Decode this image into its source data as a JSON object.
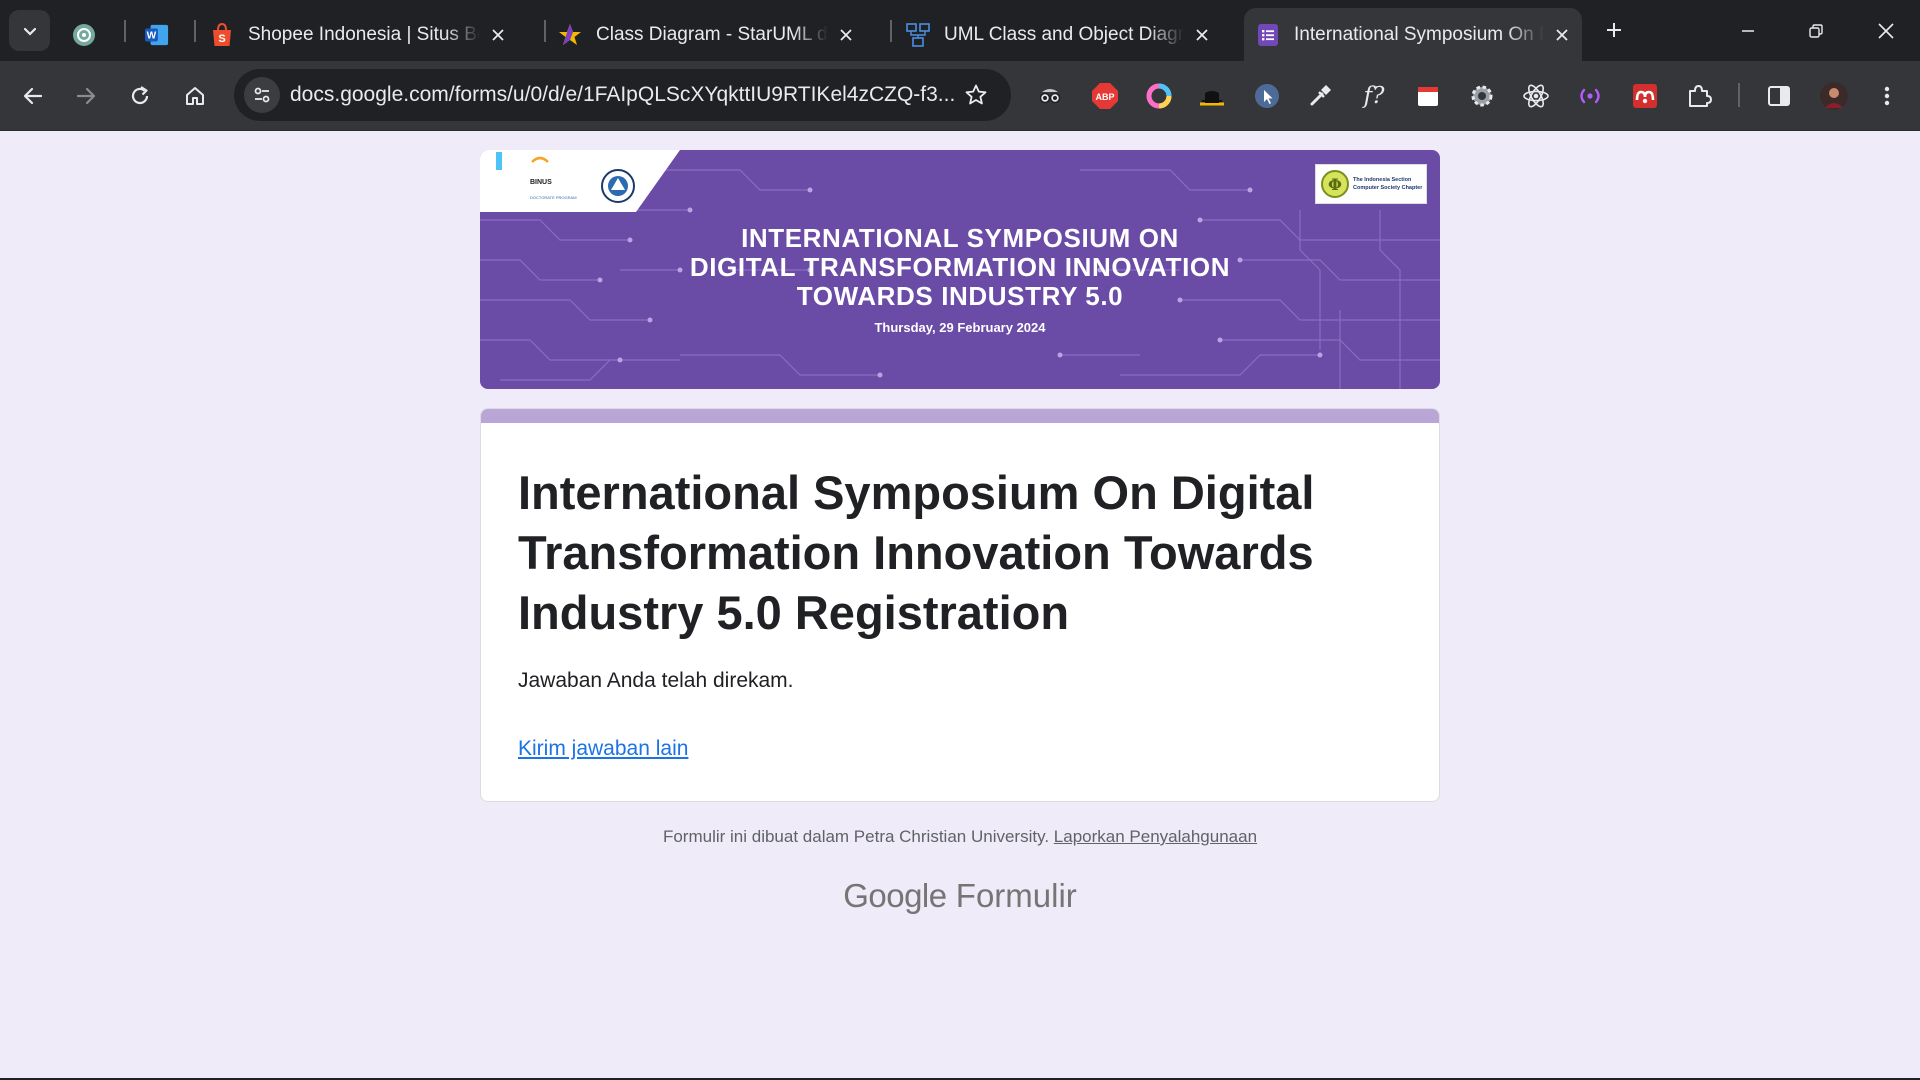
{
  "browser": {
    "tabs": [
      {
        "title": "",
        "icon": "chatgpt-icon",
        "pinned": true
      },
      {
        "title": "",
        "icon": "word-icon",
        "pinned": true
      },
      {
        "title": "Shopee Indonesia | Situs Belanja",
        "icon": "shopee-icon"
      },
      {
        "title": "Class Diagram - StarUML documentation",
        "icon": "staruml-icon"
      },
      {
        "title": "UML Class and Object Diagram",
        "icon": "uml-icon"
      },
      {
        "title": "International Symposium On Digital",
        "icon": "google-forms-icon",
        "active": true
      }
    ],
    "url": "docs.google.com/forms/u/0/d/e/1FAIpQLScXYqkttIU9RTIKel4zCZQ-f3...",
    "extensions": [
      "spy-glasses-icon",
      "abp-icon",
      "color-ring-icon",
      "hat-icon",
      "cursor-icon",
      "eyedropper-icon",
      "font-question-icon",
      "calendar-icon",
      "gear-icon",
      "react-icon",
      "broadcast-icon",
      "mendeley-icon",
      "puzzle-icon",
      "side-panel-icon",
      "profile-avatar",
      "menu-icon"
    ],
    "ext_labels": {
      "abp": "ABP",
      "font": "f?"
    }
  },
  "banner": {
    "title_lines": [
      "INTERNATIONAL SYMPOSIUM ON",
      "DIGITAL TRANSFORMATION INNOVATION",
      "TOWARDS INDUSTRY 5.0"
    ],
    "date": "Thursday, 29 February 2024",
    "logo_left_text": "BINUS",
    "logo_left_sub": "DOCTORATE PROGRAM",
    "logo_right_text_1": "The Indonesia Section",
    "logo_right_text_2": "Computer Society Chapter",
    "colors": {
      "background": "#6a4ba6",
      "circuit": "#8f74c9"
    }
  },
  "form": {
    "title": "International Symposium On Digital Transformation Innovation Towards Industry 5.0 Registration",
    "message": "Jawaban Anda telah direkam.",
    "link": "Kirim jawaban lain",
    "accent_color": "#b9a6d6"
  },
  "footer": {
    "text": "Formulir ini dibuat dalam Petra Christian University.",
    "abuse_link": "Laporkan Penyalahgunaan",
    "brand_google": "Google",
    "brand_product": "Formulir"
  }
}
